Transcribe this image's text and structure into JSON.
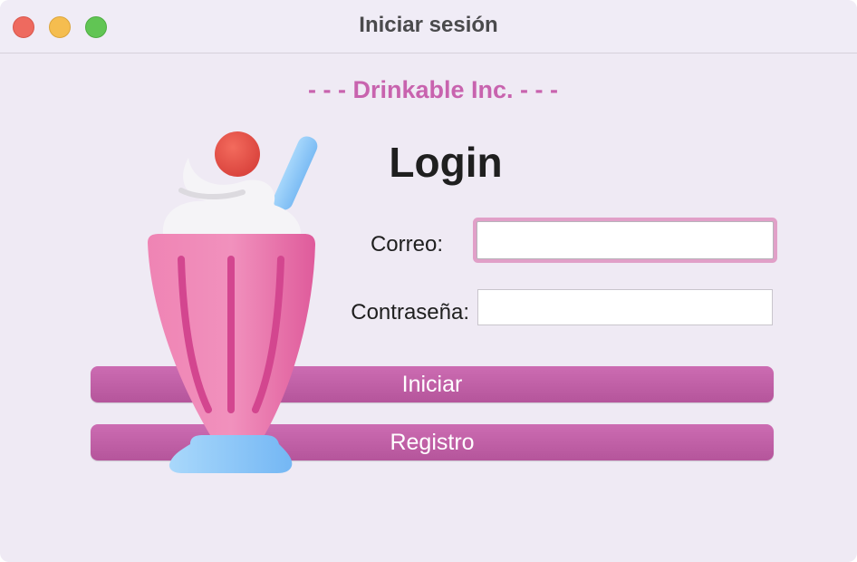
{
  "window": {
    "title": "Iniciar sesión"
  },
  "brand": {
    "text": "- - - Drinkable Inc. - - -",
    "color": "#c863ae"
  },
  "login": {
    "heading": "Login",
    "email_label": "Correo:",
    "email_value": "",
    "password_label": "Contraseña:",
    "password_value": ""
  },
  "buttons": {
    "login_label": "Iniciar",
    "register_label": "Registro"
  },
  "illustration": {
    "icon": "milkshake-icon"
  },
  "colors": {
    "accent": "#c863ae",
    "button": "#c063a8",
    "focus_ring": "#e1a0c8"
  }
}
